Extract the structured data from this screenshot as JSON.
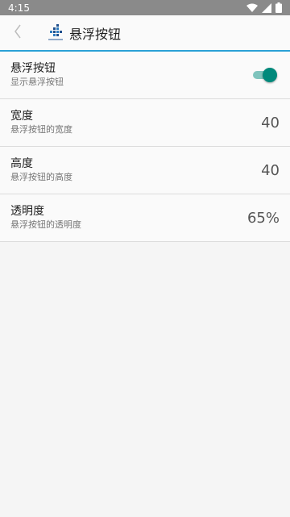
{
  "status_bar": {
    "time": "4:15",
    "icons": [
      "android-icon",
      "wifi-icon",
      "signal-icon",
      "battery-icon"
    ]
  },
  "app_bar": {
    "title": "悬浮按钮",
    "accent_color": "#2aa0d6"
  },
  "settings": [
    {
      "title": "悬浮按钮",
      "subtitle": "显示悬浮按钮",
      "type": "toggle",
      "checked": true
    },
    {
      "title": "宽度",
      "subtitle": "悬浮按钮的宽度",
      "type": "value",
      "value": "40"
    },
    {
      "title": "高度",
      "subtitle": "悬浮按钮的高度",
      "type": "value",
      "value": "40"
    },
    {
      "title": "透明度",
      "subtitle": "悬浮按钮的透明度",
      "type": "value",
      "value": "65%"
    }
  ],
  "colors": {
    "toggle_on": "#00897b",
    "status_bar": "#8a8a8a"
  }
}
